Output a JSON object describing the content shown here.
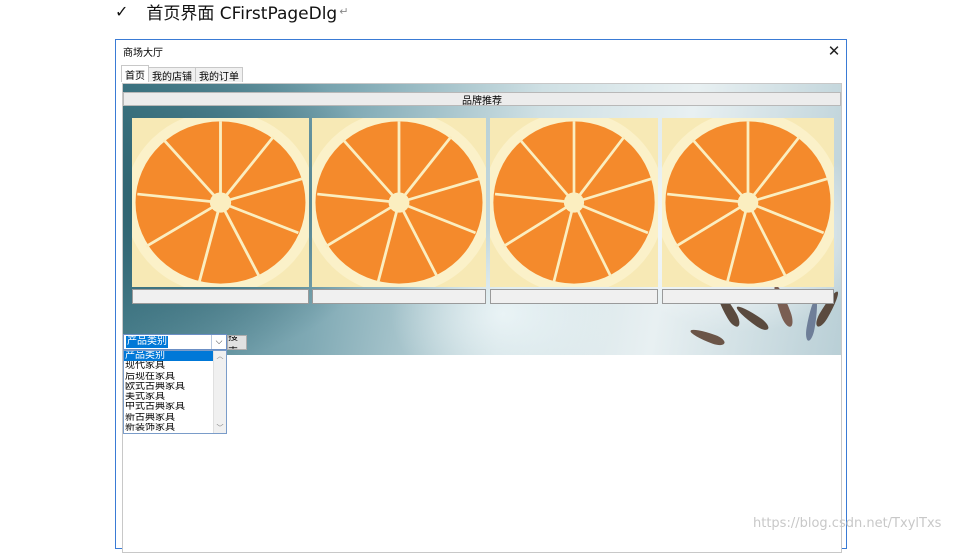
{
  "heading": {
    "checkmark": "✓",
    "text": "首页界面 CFirstPageDlg",
    "para_mark": "↵"
  },
  "dialog": {
    "title": "商场大厅",
    "close_icon": "close-icon"
  },
  "tabs": [
    {
      "label": "首页",
      "active": true
    },
    {
      "label": "我的店铺",
      "active": false
    },
    {
      "label": "我的订单",
      "active": false
    }
  ],
  "home": {
    "brand_bar": "品牌推荐",
    "brand_images": [
      "orange-slice",
      "orange-slice",
      "orange-slice",
      "orange-slice"
    ],
    "brand_labels": [
      "",
      "",
      "",
      ""
    ],
    "category_select": {
      "value": "产品类别",
      "options": [
        "产品类别",
        "现代家具",
        "后现在家具",
        "欧式古典家具",
        "美式家具",
        "中式古典家具",
        "新古典家具",
        "新装饰家具"
      ]
    },
    "search_label": "搜索"
  },
  "watermark": "https://blog.csdn.net/TxylTxs",
  "colors": {
    "accent": "#0078d7",
    "dialog_border": "#3a7bd5",
    "orange": "#f4892a"
  }
}
